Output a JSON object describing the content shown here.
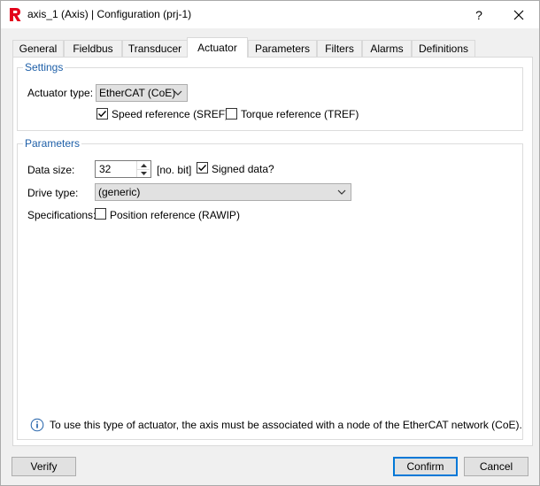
{
  "window": {
    "title": "axis_1 (Axis) | Configuration (prj-1)",
    "help_label": "?",
    "close_label": "✕"
  },
  "tabs": [
    {
      "label": "General"
    },
    {
      "label": "Fieldbus"
    },
    {
      "label": "Transducer"
    },
    {
      "label": "Actuator"
    },
    {
      "label": "Parameters"
    },
    {
      "label": "Filters"
    },
    {
      "label": "Alarms"
    },
    {
      "label": "Definitions"
    }
  ],
  "active_tab": "Actuator",
  "settings": {
    "title": "Settings",
    "actuator_type_label": "Actuator type:",
    "actuator_type_value": "EtherCAT (CoE)",
    "speed_ref_label": "Speed reference (SREF)",
    "speed_ref_checked": true,
    "torque_ref_label": "Torque reference (TREF)",
    "torque_ref_checked": false
  },
  "parameters": {
    "title": "Parameters",
    "data_size_label": "Data size:",
    "data_size_value": "32",
    "data_size_unit": "[no. bit]",
    "signed_label": "Signed data?",
    "signed_checked": true,
    "drive_type_label": "Drive type:",
    "drive_type_value": "(generic)",
    "specs_label": "Specifications:",
    "position_ref_label": "Position reference (RAWIP)",
    "position_ref_checked": false,
    "info_text": "To use this type of actuator, the axis must be associated with a node of the EtherCAT network (CoE)."
  },
  "buttons": {
    "verify": "Verify",
    "confirm": "Confirm",
    "cancel": "Cancel"
  },
  "colors": {
    "accent": "#0078d7",
    "group_title": "#1e5fa8",
    "logo_red": "#e3001b"
  }
}
